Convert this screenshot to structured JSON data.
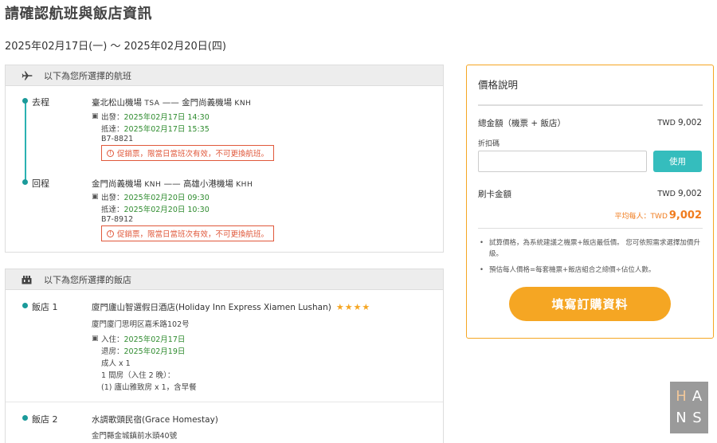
{
  "page": {
    "title": "請確認航班與飯店資訊",
    "date_range": "2025年02月17日(一) ～ 2025年02月20日(四)"
  },
  "flights": {
    "header": "以下為您所選擇的航班",
    "header_icon": "airplane-icon",
    "legs": [
      {
        "label": "去程",
        "from": "臺北松山機場",
        "from_code": "TSA",
        "to": "金門尚義機場",
        "to_code": "KNH",
        "depart_label": "出發：",
        "depart": "2025年02月17日 14:30",
        "arrive_label": "抵達：",
        "arrive": "2025年02月17日 15:35",
        "flight_no": "B7-8821",
        "warning": "促銷票，限當日當班次有效，不可更換航班。"
      },
      {
        "label": "回程",
        "from": "金門尚義機場",
        "from_code": "KNH",
        "to": "高雄小港機場",
        "to_code": "KHH",
        "depart_label": "出發：",
        "depart": "2025年02月20日 09:30",
        "arrive_label": "抵達：",
        "arrive": "2025年02月20日 10:30",
        "flight_no": "B7-8912",
        "warning": "促銷票，限當日當班次有效，不可更換航班。"
      }
    ],
    "dash": "——"
  },
  "hotels": {
    "header": "以下為您所選擇的飯店",
    "header_icon": "hotel-icon",
    "items": [
      {
        "label": "飯店 1",
        "name": "廈門廬山智選假日酒店(Holiday Inn Express Xiamen Lushan)",
        "stars": "★★★★",
        "address": "廈門廈门思明区嘉禾路102号",
        "checkin_label": "入住：",
        "checkin": "2025年02月17日",
        "checkout_label": "退房：",
        "checkout": "2025年02月19日",
        "guests": "成人 x 1",
        "rooms": "1 間房（入住 2 晚）：",
        "room_type": "(1) 廬山雅致房 x 1，含早餐"
      },
      {
        "label": "飯店 2",
        "name": "水調歌頭民宿(Grace Homestay)",
        "address": "金門縣金城鎮前水頭40號"
      }
    ]
  },
  "price": {
    "title": "價格說明",
    "total_label": "總金額（機票 + 飯店）",
    "total_currency": "TWD",
    "total_value": "9,002",
    "coupon_label": "折扣碼",
    "coupon_placeholder": "",
    "coupon_button": "使用",
    "card_label": "刷卡金額",
    "card_currency": "TWD",
    "card_value": "9,002",
    "avg_label": "平均每人：TWD",
    "avg_value": "9,002",
    "notes": [
      "試算價格，為系統建議之機票+飯店最低價。 您可依照需求選擇加價升級。",
      "預估每人價格=每套機票+飯店組合之總價÷佔位人數。"
    ],
    "order_button": "填寫訂購資料"
  },
  "watermark": {
    "letters": [
      "H",
      "A",
      "N",
      "S"
    ]
  },
  "colors": {
    "accent_teal": "#35bdbd",
    "accent_orange": "#f5a623",
    "warning_red": "#e0583b",
    "date_green": "#2e8b2e"
  }
}
